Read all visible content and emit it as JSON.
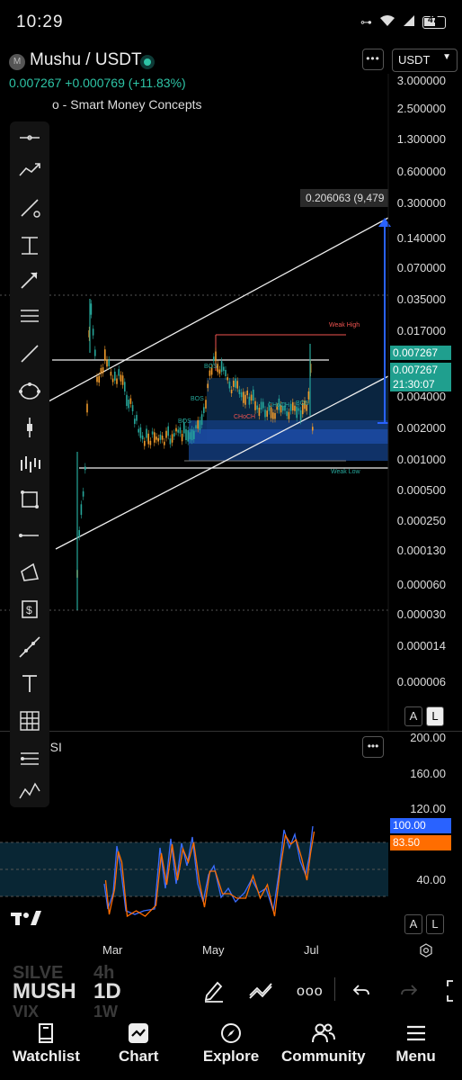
{
  "status_bar": {
    "time": "10:29",
    "battery": "47"
  },
  "header": {
    "logo_letter": "M",
    "symbol": "Mushu / USDT",
    "price_line": "0.007267  +0.000769 (+11.83%)",
    "indicator": "o - Smart Money Concepts",
    "currency": "USDT",
    "menu_label": "•••"
  },
  "price_axis": [
    "3.000000",
    "2.500000",
    "1.300000",
    "0.600000",
    "0.300000",
    "0.140000",
    "0.070000",
    "0.035000",
    "0.017000",
    "0.007267",
    "0.004000",
    "0.002000",
    "0.001000",
    "0.000500",
    "0.000250",
    "0.000130",
    "0.000060",
    "0.000030",
    "0.000014",
    "0.000006"
  ],
  "tooltip_price": "0.206063 (9,479",
  "current_price_tags": {
    "top": "0.007267",
    "middle": "0.007267",
    "countdown": "21:30:07"
  },
  "chart_labels": {
    "weak_high": "Weak High",
    "weak_low": "Weak Low",
    "bos": "BOS",
    "choch": "CHoCH"
  },
  "scale_buttons": {
    "a": "A",
    "l": "L"
  },
  "rsi": {
    "title": "RSI",
    "axis": [
      "200.00",
      "160.00",
      "120.00",
      "100.00",
      "83.50",
      "40.00"
    ],
    "value_tag_1": "100.00",
    "value_tag_2": "83.50"
  },
  "time_axis": [
    "Mar",
    "May",
    "Jul"
  ],
  "bottom_tools": {
    "watch_rows": [
      "SILVE",
      "MUSH",
      "VIX"
    ],
    "intervals": [
      "4h",
      "1D",
      "1W"
    ]
  },
  "nav": [
    {
      "label": "Watchlist",
      "icon": "book-icon"
    },
    {
      "label": "Chart",
      "icon": "chart-icon"
    },
    {
      "label": "Explore",
      "icon": "compass-icon"
    },
    {
      "label": "Community",
      "icon": "people-icon"
    },
    {
      "label": "Menu",
      "icon": "hamburger-icon"
    }
  ],
  "colors": {
    "accent_green": "#2ec4a6",
    "blue": "#2962ff",
    "orange": "#ff6d00",
    "red": "#ef5350"
  }
}
